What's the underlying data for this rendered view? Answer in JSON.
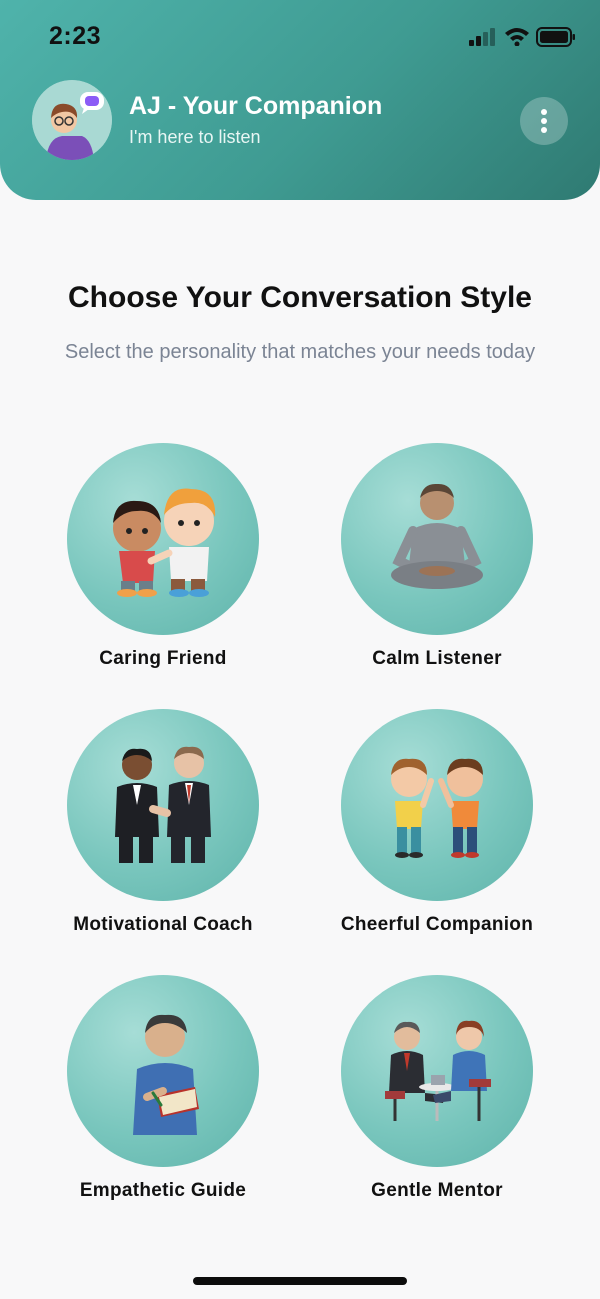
{
  "status": {
    "time": "2:23"
  },
  "header": {
    "title": "AJ - Your Companion",
    "subtitle": "I'm here to listen",
    "accent": "#3f9b92"
  },
  "main": {
    "title": "Choose Your Conversation Style",
    "subtitle": "Select the personality that matches your needs today",
    "styles": [
      {
        "label": "Caring Friend",
        "icon": "two-kids-comforting-icon"
      },
      {
        "label": "Calm Listener",
        "icon": "meditating-person-icon"
      },
      {
        "label": "Motivational Coach",
        "icon": "handshake-businessmen-icon"
      },
      {
        "label": "Cheerful Companion",
        "icon": "waving-kids-icon"
      },
      {
        "label": "Empathetic Guide",
        "icon": "person-with-notebook-icon"
      },
      {
        "label": "Gentle Mentor",
        "icon": "mentor-meeting-icon"
      }
    ]
  }
}
